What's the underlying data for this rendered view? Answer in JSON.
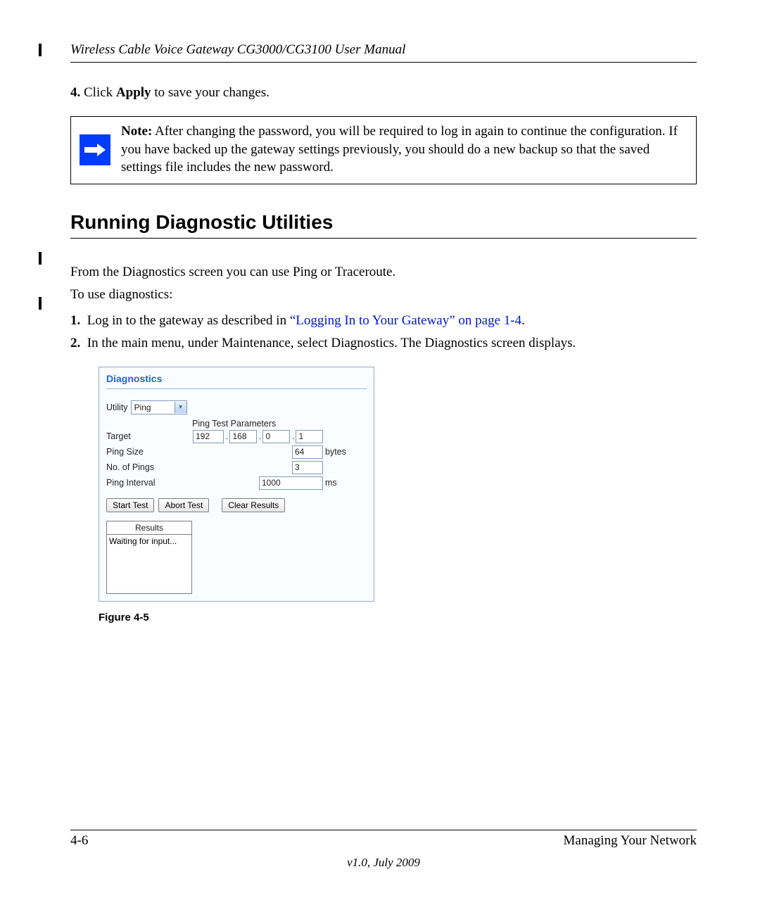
{
  "header": {
    "title": "Wireless Cable Voice Gateway CG3000/CG3100 User Manual"
  },
  "step4": {
    "num": "4.",
    "pre": "Click ",
    "bold": "Apply",
    "post": " to save your changes."
  },
  "note": {
    "label": "Note:",
    "text": " After changing the password, you will be required to log in again to continue the configuration. If you have backed up the gateway settings previously, you should do a new backup so that the saved settings file includes the new password."
  },
  "section_heading": "Running Diagnostic Utilities",
  "intro1": "From the Diagnostics screen you can use Ping or Traceroute.",
  "intro2": "To use diagnostics:",
  "steps": {
    "s1": {
      "num": "1.",
      "pre": "Log in to the gateway as described in ",
      "link": "“Logging In to Your Gateway” on page 1-4",
      "post": "."
    },
    "s2": {
      "num": "2.",
      "text": "In the main menu, under Maintenance, select Diagnostics. The Diagnostics screen displays."
    }
  },
  "diag": {
    "title": "Diagnostics",
    "utility_label": "Utility",
    "utility_value": "Ping",
    "params_title": "Ping Test Parameters",
    "labels": {
      "target": "Target",
      "ping_size": "Ping Size",
      "no_pings": "No. of Pings",
      "ping_interval": "Ping Interval"
    },
    "values": {
      "ip1": "192",
      "ip2": "168",
      "ip3": "0",
      "ip4": "1",
      "ping_size": "64",
      "no_pings": "3",
      "ping_interval": "1000"
    },
    "units": {
      "bytes": "bytes",
      "ms": "ms"
    },
    "buttons": {
      "start": "Start Test",
      "abort": "Abort Test",
      "clear": "Clear Results"
    },
    "results_title": "Results",
    "results_text": "Waiting for input..."
  },
  "fig_caption": "Figure 4-5",
  "footer": {
    "page": "4-6",
    "section": "Managing Your Network",
    "version": "v1.0, July 2009"
  }
}
